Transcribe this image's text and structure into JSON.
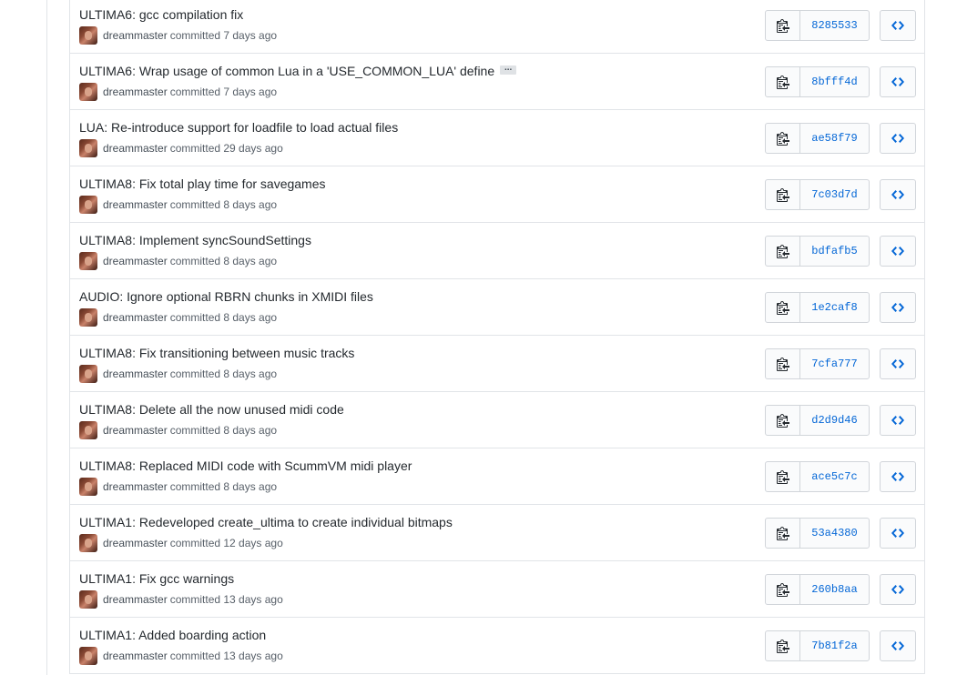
{
  "colors": {
    "sha_link": "#0366d6",
    "title_text": "#24292e",
    "meta_text": "#586069",
    "border": "#e1e4e8"
  },
  "icons": {
    "copy": "clippy-icon",
    "browse": "code-icon",
    "expand": "ellipsis-icon"
  },
  "commits": [
    {
      "title": "ULTIMA6: gcc compilation fix",
      "has_ellipsis": false,
      "author": "dreammaster",
      "action": "committed 7 days ago",
      "sha": "8285533"
    },
    {
      "title": "ULTIMA6: Wrap usage of common Lua in a 'USE_COMMON_LUA' define",
      "has_ellipsis": true,
      "ellipsis": "...",
      "author": "dreammaster",
      "action": "committed 7 days ago",
      "sha": "8bfff4d"
    },
    {
      "title": "LUA: Re-introduce support for loadfile to load actual files",
      "has_ellipsis": false,
      "author": "dreammaster",
      "action": "committed 29 days ago",
      "sha": "ae58f79"
    },
    {
      "title": "ULTIMA8: Fix total play time for savegames",
      "has_ellipsis": false,
      "author": "dreammaster",
      "action": "committed 8 days ago",
      "sha": "7c03d7d"
    },
    {
      "title": "ULTIMA8: Implement syncSoundSettings",
      "has_ellipsis": false,
      "author": "dreammaster",
      "action": "committed 8 days ago",
      "sha": "bdfafb5"
    },
    {
      "title": "AUDIO: Ignore optional RBRN chunks in XMIDI files",
      "has_ellipsis": false,
      "author": "dreammaster",
      "action": "committed 8 days ago",
      "sha": "1e2caf8"
    },
    {
      "title": "ULTIMA8: Fix transitioning between music tracks",
      "has_ellipsis": false,
      "author": "dreammaster",
      "action": "committed 8 days ago",
      "sha": "7cfa777"
    },
    {
      "title": "ULTIMA8: Delete all the now unused midi code",
      "has_ellipsis": false,
      "author": "dreammaster",
      "action": "committed 8 days ago",
      "sha": "d2d9d46"
    },
    {
      "title": "ULTIMA8: Replaced MIDI code with ScummVM midi player",
      "has_ellipsis": false,
      "author": "dreammaster",
      "action": "committed 8 days ago",
      "sha": "ace5c7c"
    },
    {
      "title": "ULTIMA1: Redeveloped create_ultima to create individual bitmaps",
      "has_ellipsis": false,
      "author": "dreammaster",
      "action": "committed 12 days ago",
      "sha": "53a4380"
    },
    {
      "title": "ULTIMA1: Fix gcc warnings",
      "has_ellipsis": false,
      "author": "dreammaster",
      "action": "committed 13 days ago",
      "sha": "260b8aa"
    },
    {
      "title": "ULTIMA1: Added boarding action",
      "has_ellipsis": false,
      "author": "dreammaster",
      "action": "committed 13 days ago",
      "sha": "7b81f2a"
    }
  ]
}
